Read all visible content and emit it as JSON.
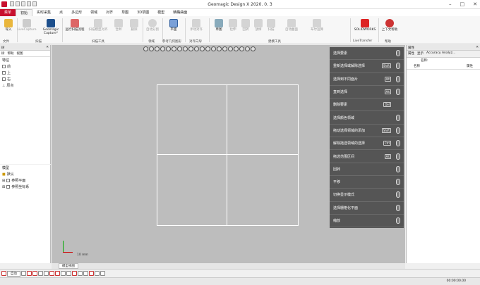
{
  "window": {
    "title": "Geomagic Design X 2020. 0. 3"
  },
  "tabs": [
    "实时采集",
    "点",
    "多边形",
    "领域",
    "对齐",
    "草图",
    "3D草图",
    "模型",
    "精确曲面"
  ],
  "tab_file": "菜单",
  "tab_active": "初始",
  "ribbon": {
    "import": "导入",
    "livecapture": "LiveCapture",
    "capture": "Geomagic Capture*",
    "scanwizard": "运行扫描流程",
    "group_file": "文件",
    "group_scan": "扫描",
    "group_scantools": "扫描工具",
    "group_region": "领域",
    "group_ref": "参考几何图形",
    "group_align": "对齐向导",
    "group_model": "建模工具",
    "group_live": "LiveTransfer",
    "group_help": "帮助",
    "btn_b1": "扫描模型对齐",
    "btn_b2": "合并",
    "btn_b3": "删除",
    "btn_auto": "自动分割",
    "btn_plane": "平面",
    "btn_manual": "手动对齐",
    "btn_sketch": "草图",
    "btn_extrude": "拉伸",
    "btn_revolve": "回转",
    "btn_sweep": "放样",
    "btn_loft": "扫描",
    "btn_autosurf": "自动曲面",
    "btn_boolean": "布尔运算",
    "btn_solidworks": "SOLIDWORKS",
    "btn_help": "上下文帮助"
  },
  "tree": {
    "header": "树",
    "tab1": "帮助",
    "tab2": "视图",
    "title": "特征",
    "items": [
      "前",
      "上",
      "右",
      "原点"
    ]
  },
  "model": {
    "title": "模型",
    "items": [
      "默认",
      "参照平面",
      "参照坐标系"
    ]
  },
  "menu": [
    {
      "label": "选择要素",
      "key": ""
    },
    {
      "label": "重新选择或解除选择",
      "key": "Shift"
    },
    {
      "label": "选择到不同面片",
      "key": "Alt"
    },
    {
      "label": "直到选择",
      "key": "Alt"
    },
    {
      "label": "删除要素",
      "key": "Del"
    },
    {
      "label": "选择颜色领域",
      "key": ""
    },
    {
      "label": "拖动选择领域的添加",
      "key": "Shift"
    },
    {
      "label": "解除拖选领域的选择",
      "key": "Ctrl"
    },
    {
      "label": "拖选范围区间",
      "key": "Alt"
    },
    {
      "label": "回转",
      "key": ""
    },
    {
      "label": "平移",
      "key": ""
    },
    {
      "label": "切换显示模式",
      "key": ""
    },
    {
      "label": "选择栅格化平面",
      "key": ""
    },
    {
      "label": "缩放",
      "key": ""
    }
  ],
  "scale": "10 mm",
  "right": {
    "header": "属性",
    "tab1": "属性",
    "tab2": "显示",
    "tab3": "Accuracy Analyz...",
    "name_label": "名称:",
    "col1": "名称",
    "col2": "属性"
  },
  "bottom": {
    "tab": "模型视图",
    "mode": "自动"
  },
  "status": {
    "coords": "00:00:00.00"
  },
  "colors": {
    "accent": "#c8102e",
    "menu_bg": "#555555",
    "viewport": "#bdbdbd"
  }
}
